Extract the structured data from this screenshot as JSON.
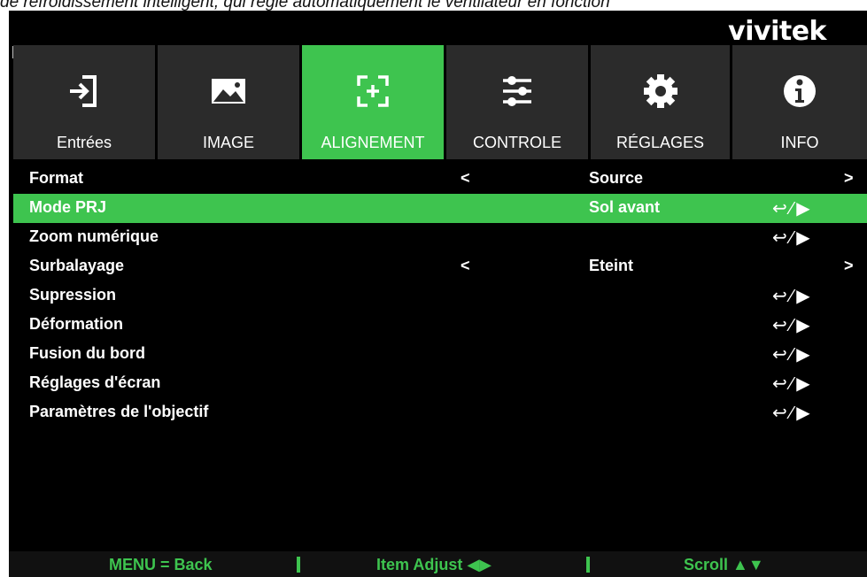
{
  "header": {
    "doc_text": "de refroidissement intelligent, qui règle automatiquement le ventilateur en fonction",
    "brand": "vivitek"
  },
  "tabs": [
    {
      "label": "Entrées",
      "icon": "input-icon",
      "active": false
    },
    {
      "label": "IMAGE",
      "icon": "image-icon",
      "active": false
    },
    {
      "label": "ALIGNEMENT",
      "icon": "alignment-icon",
      "active": true
    },
    {
      "label": "CONTROLE",
      "icon": "sliders-icon",
      "active": false
    },
    {
      "label": "RÉGLAGES",
      "icon": "gear-icon",
      "active": false
    },
    {
      "label": "INFO",
      "icon": "info-icon",
      "active": false
    }
  ],
  "menu": [
    {
      "name": "Format",
      "left": "<",
      "value": "Source",
      "right": ">"
    },
    {
      "name": "Mode PRJ",
      "value": "Sol avant",
      "enter": "↩ ⁄ ▶",
      "selected": true
    },
    {
      "name": "Zoom numérique",
      "enter": "↩ ⁄ ▶"
    },
    {
      "name": "Surbalayage",
      "left": "<",
      "value": "Eteint",
      "right": ">"
    },
    {
      "name": "Supression",
      "enter": "↩ ⁄ ▶"
    },
    {
      "name": "Déformation",
      "enter": "↩ ⁄ ▶"
    },
    {
      "name": "Fusion du bord",
      "enter": "↩ ⁄ ▶"
    },
    {
      "name": "Réglages d'écran",
      "enter": "↩ ⁄ ▶"
    },
    {
      "name": "Paramètres de l'objectif",
      "enter": "↩ ⁄ ▶"
    }
  ],
  "footer": {
    "back": "MENU = Back",
    "adjust": "Item Adjust ◀▶",
    "scroll": "Scroll ▲▼"
  },
  "colors": {
    "accent": "#3ec44f",
    "background": "#000000",
    "tab_bg": "#2b2b2b"
  }
}
